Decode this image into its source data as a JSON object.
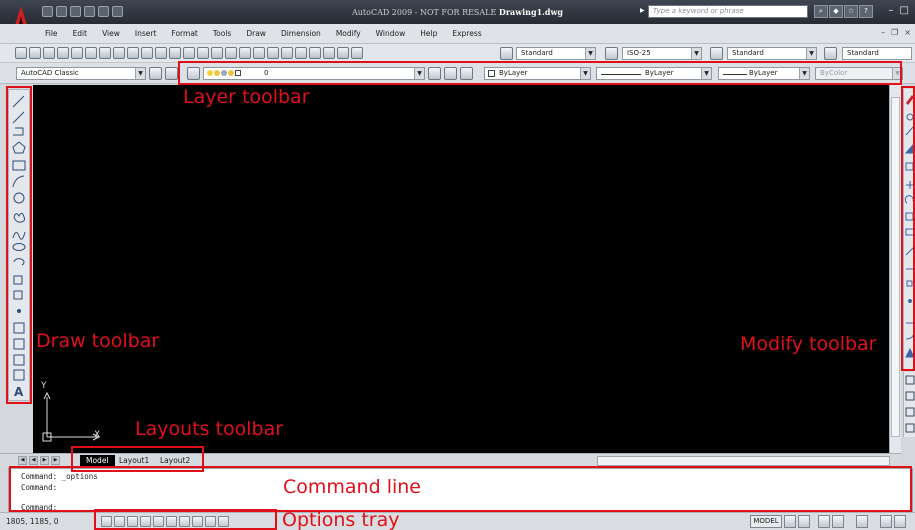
{
  "window": {
    "title_prefix": "AutoCAD 2009 - NOT FOR RESALE",
    "document": "Drawing1.dwg",
    "search_placeholder": "Type a keyword or phrase"
  },
  "menu": [
    "File",
    "Edit",
    "View",
    "Insert",
    "Format",
    "Tools",
    "Draw",
    "Dimension",
    "Modify",
    "Window",
    "Help",
    "Express"
  ],
  "standard_toolbar": {
    "text_style": "Standard",
    "dim_style": "ISO-25",
    "table_style": "Standard",
    "multileader_style": "Standard"
  },
  "layer_toolbar": {
    "workspace": "AutoCAD Classic",
    "current_layer": "0",
    "color": "ByLayer",
    "linetype": "ByLayer",
    "lineweight": "ByLayer",
    "plot_style": "ByColor"
  },
  "ucs": {
    "x_label": "X",
    "y_label": "Y"
  },
  "layout_tabs": [
    "Model",
    "Layout1",
    "Layout2"
  ],
  "command_line": {
    "line1": "Command:  _options",
    "line2": "Command:",
    "line3": "Command:"
  },
  "status_bar": {
    "coordinates": "1805, 1185, 0",
    "space": "MODEL"
  },
  "annotations": {
    "layer": "Layer toolbar",
    "draw": "Draw toolbar",
    "modify": "Modify toolbar",
    "layouts": "Layouts toolbar",
    "command": "Command line",
    "options": "Options tray"
  },
  "colors": {
    "annotation": "#e0101a",
    "drawing_background": "#000000",
    "title_bar": "#2d333c"
  }
}
